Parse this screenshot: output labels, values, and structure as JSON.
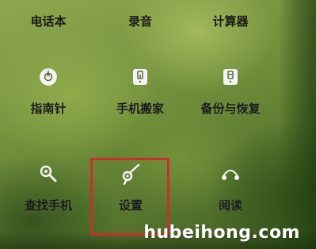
{
  "top_row": [
    {
      "label": "电话本"
    },
    {
      "label": "录音"
    },
    {
      "label": "计算器"
    }
  ],
  "grid": [
    {
      "label": "指南针",
      "icon": "compass-icon"
    },
    {
      "label": "手机搬家",
      "icon": "phone-clone-icon"
    },
    {
      "label": "备份与恢复",
      "icon": "backup-restore-icon"
    },
    {
      "label": "查找手机",
      "icon": "find-phone-icon"
    },
    {
      "label": "设置",
      "icon": "settings-icon"
    },
    {
      "label": "阅读",
      "icon": "reading-icon"
    }
  ],
  "highlight_color": "#c9302c",
  "watermark": "hubeihong.com"
}
